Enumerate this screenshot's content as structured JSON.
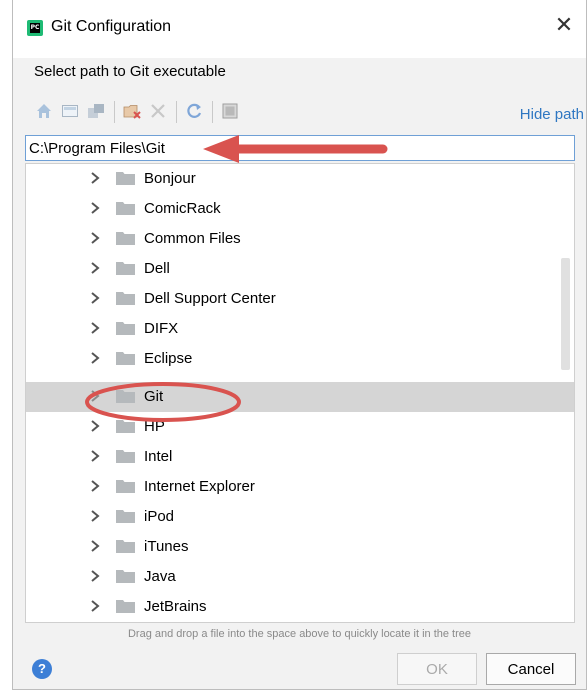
{
  "window": {
    "title": "Git Configuration",
    "app_icon_text": "PC"
  },
  "dialog": {
    "description": "Select path to Git executable"
  },
  "toolbar": {
    "icons": [
      "home-icon",
      "desktop-icon",
      "project-icon",
      "new-folder-icon",
      "delete-icon",
      "refresh-icon",
      "show-hidden-icon"
    ],
    "hide_path_label": "Hide path"
  },
  "path": {
    "value": "C:\\Program Files\\Git"
  },
  "tree": {
    "items": [
      {
        "label": "Bonjour"
      },
      {
        "label": "ComicRack"
      },
      {
        "label": "Common Files"
      },
      {
        "label": "Dell"
      },
      {
        "label": "Dell Support Center"
      },
      {
        "label": "DIFX"
      },
      {
        "label": "Eclipse"
      },
      {
        "label": "Git",
        "selected": true
      },
      {
        "label": "HP"
      },
      {
        "label": "Intel"
      },
      {
        "label": "Internet Explorer"
      },
      {
        "label": "iPod"
      },
      {
        "label": "iTunes"
      },
      {
        "label": "Java"
      },
      {
        "label": "JetBrains"
      }
    ]
  },
  "hint": "Drag and drop a file into the space above to quickly locate it in the tree",
  "buttons": {
    "help": "?",
    "ok": "OK",
    "cancel": "Cancel"
  },
  "annotation_color": "#d9534f"
}
